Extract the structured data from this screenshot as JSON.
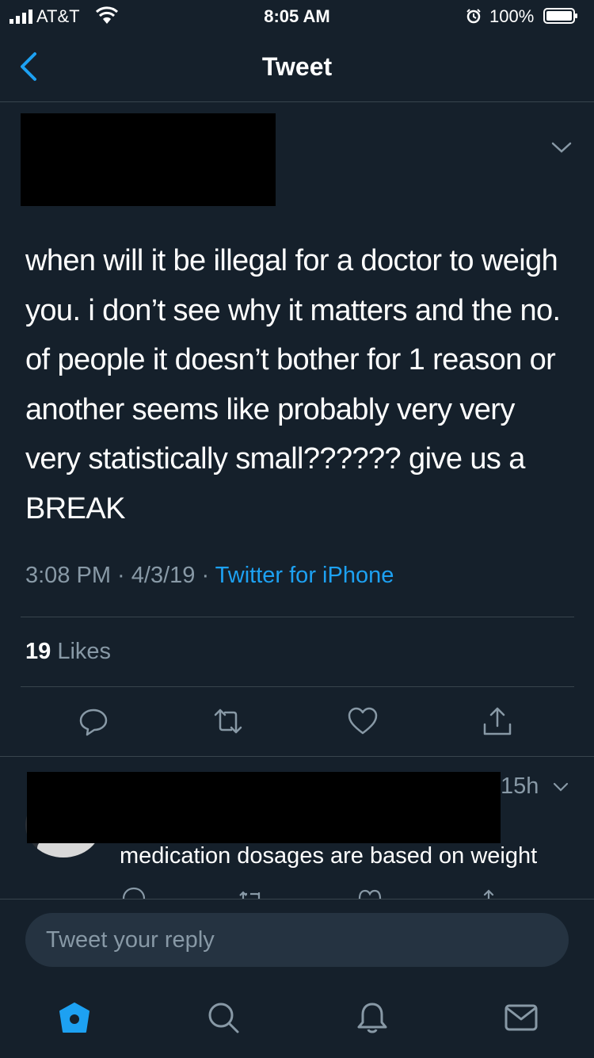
{
  "status_bar": {
    "carrier": "AT&T",
    "time": "8:05 AM",
    "battery": "100%"
  },
  "nav": {
    "title": "Tweet",
    "back_icon": "chevron-left-icon"
  },
  "tweet": {
    "text": "when will it be illegal for a doctor to weigh you. i don’t see why it matters and the no. of people it doesn’t bother for 1 reason or another seems like probably very very very statistically small?????? give us a BREAK",
    "time": "3:08 PM",
    "separator": " · ",
    "date": "4/3/19",
    "source": "Twitter for iPhone",
    "likes_count": "19",
    "likes_label": "Likes",
    "actions": [
      "reply-icon",
      "retweet-icon",
      "like-icon",
      "share-icon"
    ]
  },
  "reply": {
    "time": "15h",
    "text": "medication dosages are based on weight"
  },
  "composer": {
    "placeholder": "Tweet your reply"
  },
  "tab_bar": [
    "home-icon",
    "search-icon",
    "notifications-icon",
    "messages-icon"
  ],
  "colors": {
    "background": "#15202b",
    "divider": "#38444d",
    "secondary_text": "#8899a6",
    "accent": "#1da1f2"
  }
}
